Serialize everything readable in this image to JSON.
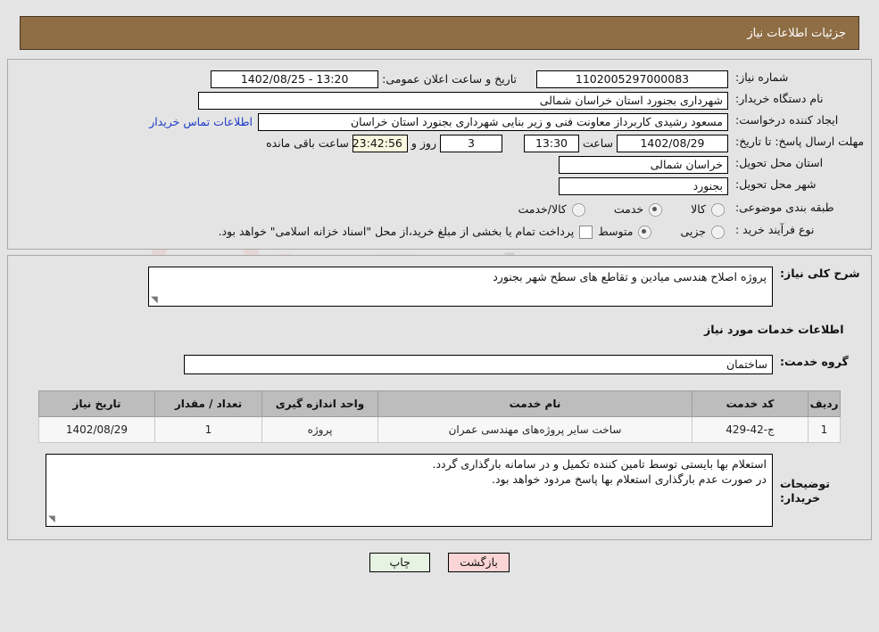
{
  "header": {
    "title": "جزئیات اطلاعات نیاز"
  },
  "summary": {
    "need_number_label": "شماره نیاز:",
    "need_number_value": "1102005297000083",
    "announce_datetime_label": "تاریخ و ساعت اعلان عمومی:",
    "announce_datetime_value": "13:20 - 1402/08/25",
    "buyer_org_label": "نام دستگاه خریدار:",
    "buyer_org_value": "شهرداری بجنورد استان خراسان شمالی",
    "creator_label": "ایجاد کننده درخواست:",
    "creator_value": "مسعود رشیدی کاربرداز معاونت فنی و زیر بنایی شهرداری بجنورد استان خراسان",
    "contact_link": "اطلاعات تماس خریدار",
    "deadline_label": "مهلت ارسال پاسخ: تا تاریخ:",
    "deadline_date": "1402/08/29",
    "hour_label": "ساعت",
    "deadline_time": "13:30",
    "remaining_days": "3",
    "days_and_label": "روز و",
    "remaining_clock": "23:42:56",
    "remaining_suffix": "ساعت باقی مانده",
    "province_label": "استان محل تحویل:",
    "province_value": "خراسان شمالی",
    "city_label": "شهر محل تحویل:",
    "city_value": "بجنورد",
    "category_label": "طبقه بندی موضوعی:",
    "category_options": [
      {
        "label": "کالا",
        "selected": false
      },
      {
        "label": "خدمت",
        "selected": true
      },
      {
        "label": "کالا/خدمت",
        "selected": false
      }
    ],
    "purchase_type_label": "نوع فرآیند خرید :",
    "purchase_type_options": [
      {
        "label": "جزیی",
        "selected": false
      },
      {
        "label": "متوسط",
        "selected": true
      }
    ],
    "treasury_note": "پرداخت تمام یا بخشی از مبلغ خرید،از محل \"اسناد خزانه اسلامی\" خواهد بود."
  },
  "details": {
    "general_desc_label": "شرح کلی نیاز:",
    "general_desc_value": "پروژه اصلاح هندسی میادین و تقاطع های سطح شهر بجنورد",
    "services_section_title": "اطلاعات خدمات مورد نیاز",
    "service_group_label": "گروه خدمت:",
    "service_group_value": "ساختمان",
    "table": {
      "columns": [
        "ردیف",
        "کد خدمت",
        "نام خدمت",
        "واحد اندازه گیری",
        "تعداد / مقدار",
        "تاریخ نیاز"
      ],
      "rows": [
        {
          "index": "1",
          "code": "ج-42-429",
          "name": "ساخت سایر پروژه‌های مهندسی عمران",
          "unit": "پروژه",
          "quantity": "1",
          "need_date": "1402/08/29"
        }
      ]
    },
    "buyer_notes_label": "توضیحات خریدار:",
    "buyer_notes_lines": [
      "استعلام بها بایستی توسط تامین کننده تکمیل و در سامانه بارگذاری گردد.",
      "در صورت عدم بارگذاری استعلام بها پاسخ مردود خواهد بود."
    ]
  },
  "footer": {
    "back_label": "بازگشت",
    "print_label": "چاپ"
  },
  "watermark": {
    "text_a": "Ana",
    "text_b": "Tender.net"
  },
  "colors": {
    "header_bg": "#8f6d45",
    "link": "#1b39c8",
    "back_btn": "#fbd5d5",
    "print_btn": "#e6f3e2",
    "table_header": "#bdbdbd"
  }
}
